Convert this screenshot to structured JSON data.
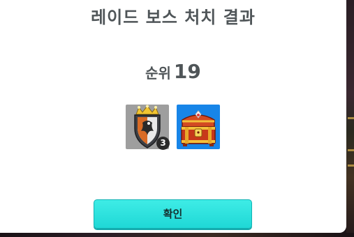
{
  "dialog": {
    "title": "레이드 보스 처치 결과",
    "rank_label": "순위",
    "rank_value": "19",
    "confirm_label": "확인"
  },
  "rewards": [
    {
      "icon": "crowned-shield-emblem-icon",
      "count": "3",
      "background": "#9e9e9e"
    },
    {
      "icon": "treasure-chest-icon",
      "background": "#1785e8"
    }
  ],
  "colors": {
    "title_text": "#4f5558",
    "button_accent": "#24dcd9",
    "modal_background": "#ffffff"
  }
}
